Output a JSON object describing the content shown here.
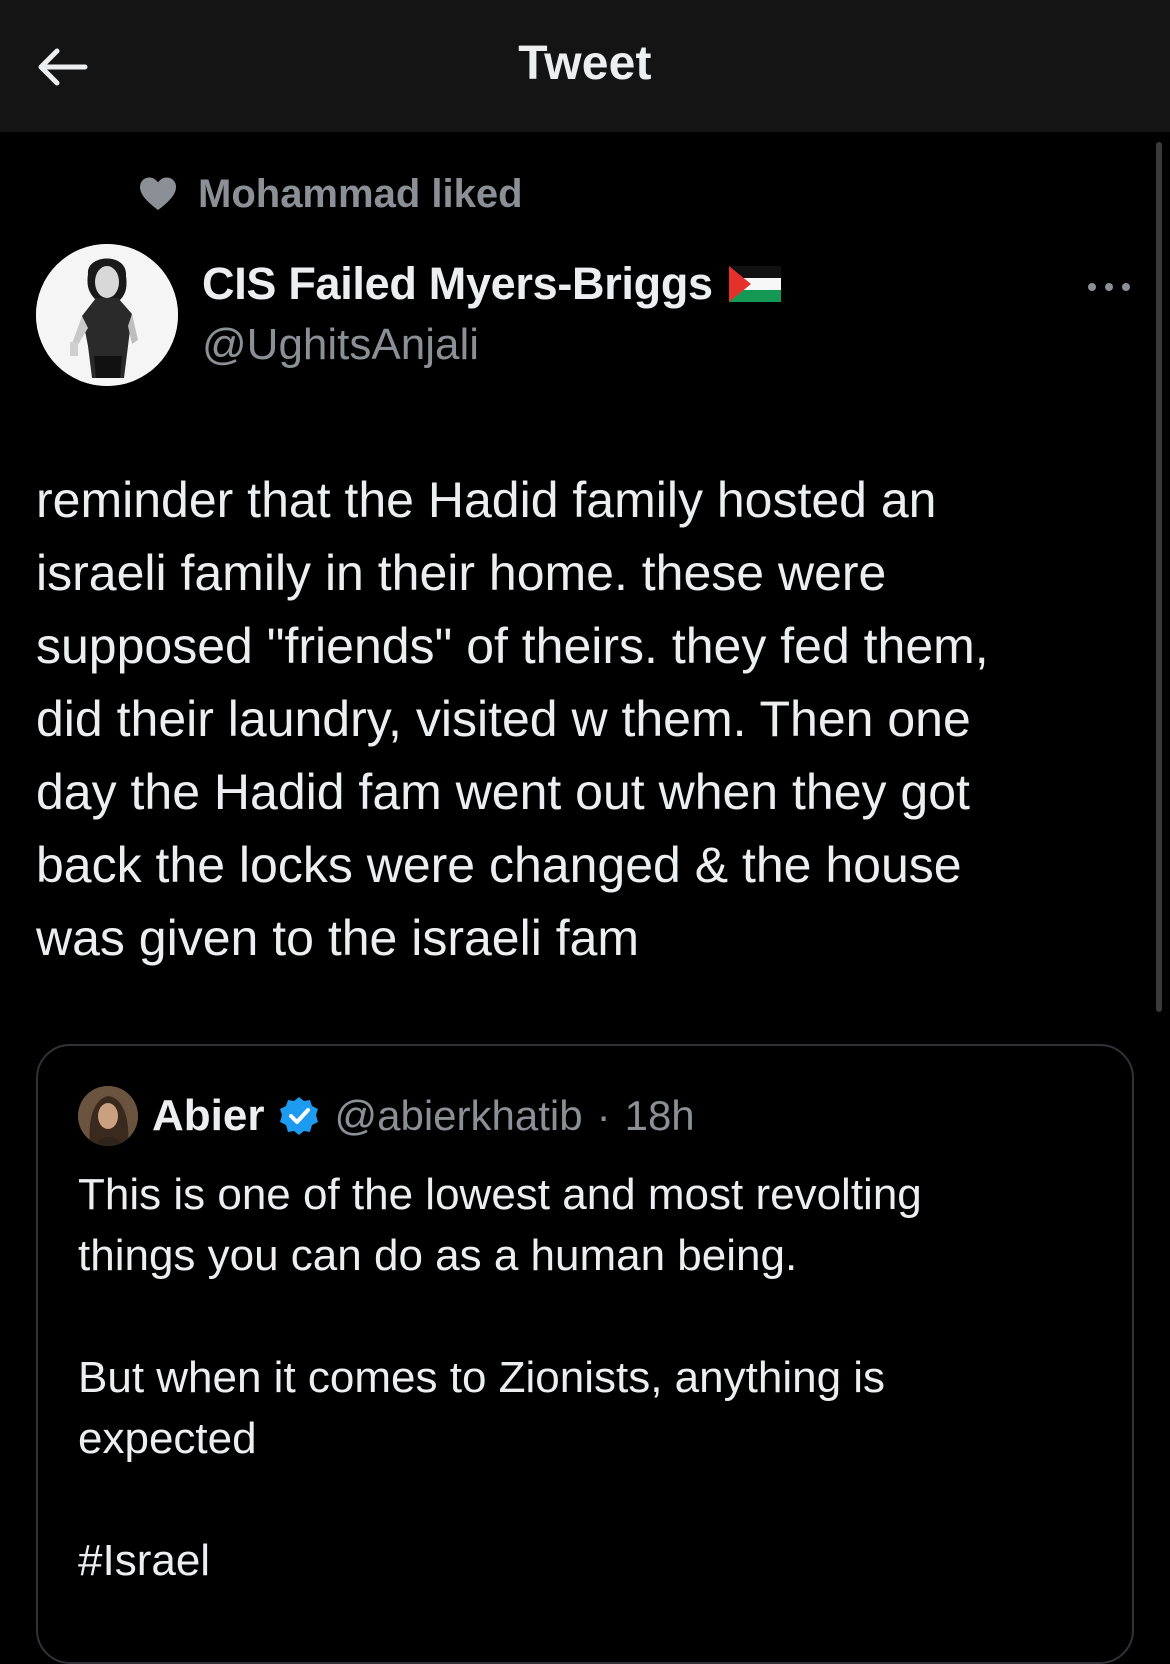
{
  "header": {
    "title": "Tweet",
    "back_icon": "arrow-left-icon",
    "background": "#141414"
  },
  "social_context": {
    "icon": "heart-icon",
    "text": "Mohammad liked"
  },
  "author": {
    "name": "CIS Failed Myers-Briggs",
    "flag_icon": "palestine-flag-icon",
    "handle": "@UghitsAnjali",
    "more_icon": "more-horizontal-icon"
  },
  "tweet": {
    "text": "reminder that the Hadid family hosted an\nisraeli family in their home. these were\nsupposed \"friends\" of theirs. they fed them,\ndid their laundry, visited w them. Then one\nday the Hadid fam went out when they got\nback the locks were changed & the house\nwas given to the israeli fam"
  },
  "quote": {
    "name": "Abier",
    "verified_icon": "verified-badge-icon",
    "verified_color": "#1d9bf0",
    "handle": "@abierkhatib",
    "separator": "·",
    "time": "18h",
    "text": "This is one of the lowest and most revolting\nthings you can do as a human being.\n\nBut when it comes to Zionists, anything is\nexpected\n\n#Israel"
  },
  "colors": {
    "background": "#000000",
    "primary_text": "#e7e9ea",
    "secondary_text": "#8b9096",
    "border": "#2f3336"
  }
}
